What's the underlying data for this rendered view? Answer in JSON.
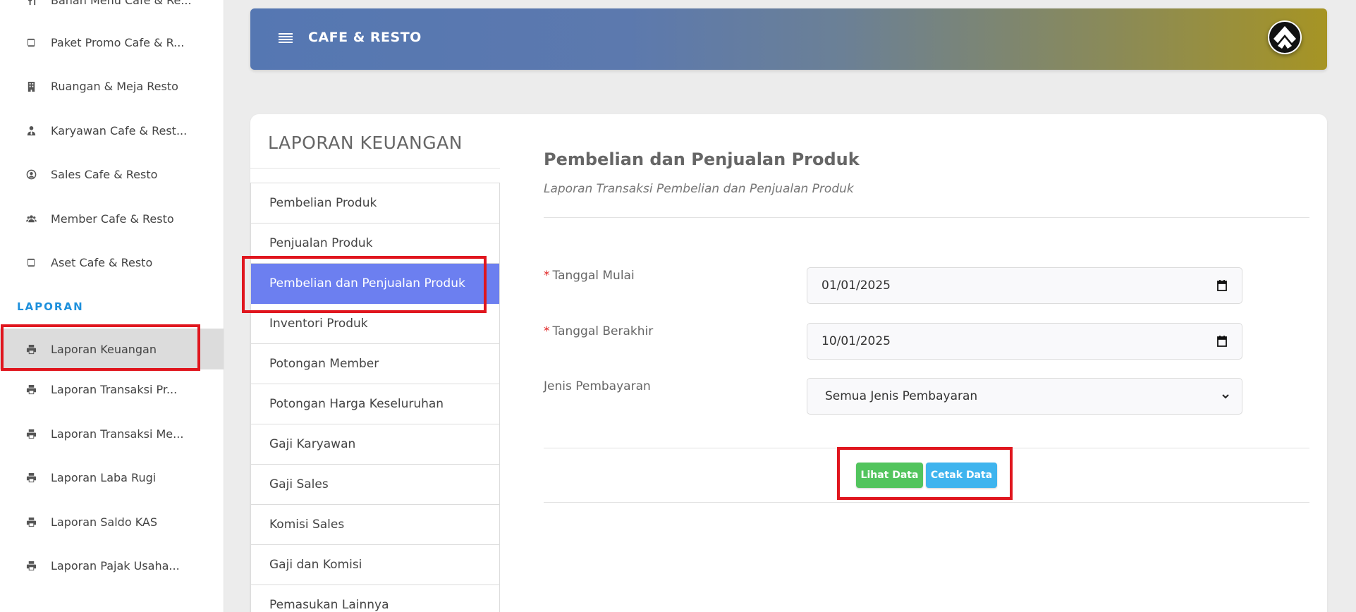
{
  "sidebar": {
    "items": [
      {
        "label": "Bahan Menu Cafe & Re...",
        "icon": "utensils-icon"
      },
      {
        "label": "Paket Promo Cafe & R...",
        "icon": "book-icon"
      },
      {
        "label": "Ruangan & Meja Resto",
        "icon": "building-icon"
      },
      {
        "label": "Karyawan Cafe & Rest...",
        "icon": "user-tie-icon"
      },
      {
        "label": "Sales Cafe & Resto",
        "icon": "user-circle-icon"
      },
      {
        "label": "Member Cafe & Resto",
        "icon": "users-icon"
      },
      {
        "label": "Aset Cafe & Resto",
        "icon": "book-icon"
      }
    ],
    "section_heading": "LAPORAN",
    "report_items": [
      {
        "label": "Laporan Keuangan",
        "icon": "print-icon",
        "active": true
      },
      {
        "label": "Laporan Transaksi Pr...",
        "icon": "print-icon"
      },
      {
        "label": "Laporan Transaksi Me...",
        "icon": "print-icon"
      },
      {
        "label": "Laporan Laba Rugi",
        "icon": "print-icon"
      },
      {
        "label": "Laporan Saldo KAS",
        "icon": "print-icon"
      },
      {
        "label": "Laporan Pajak Usaha...",
        "icon": "print-icon"
      }
    ]
  },
  "header": {
    "title": "CAFE & RESTO"
  },
  "card": {
    "title": "LAPORAN KEUANGAN",
    "menu": [
      {
        "label": "Pembelian Produk"
      },
      {
        "label": "Penjualan Produk"
      },
      {
        "label": "Pembelian dan Penjualan Produk",
        "active": true
      },
      {
        "label": "Inventori Produk"
      },
      {
        "label": "Potongan Member"
      },
      {
        "label": "Potongan Harga Keseluruhan"
      },
      {
        "label": "Gaji Karyawan"
      },
      {
        "label": "Gaji Sales"
      },
      {
        "label": "Komisi Sales"
      },
      {
        "label": "Gaji dan Komisi"
      },
      {
        "label": "Pemasukan Lainnya"
      }
    ]
  },
  "content": {
    "title": "Pembelian dan Penjualan Produk",
    "subtitle": "Laporan Transaksi Pembelian dan Penjualan Produk",
    "form": {
      "start_label": "Tanggal Mulai",
      "start_value": "01/01/2025",
      "end_label": "Tanggal Berakhir",
      "end_value": "10/01/2025",
      "payment_label": "Jenis Pembayaran",
      "payment_value": "Semua Jenis Pembayaran",
      "required_mark": "*"
    },
    "buttons": {
      "view": "Lihat Data",
      "print": "Cetak Data"
    }
  },
  "colors": {
    "accent": "#6c7ff0",
    "view_button": "#52c45d",
    "print_button": "#3fb4ee",
    "section_heading": "#1e90dc",
    "highlight": "#e0161e"
  }
}
